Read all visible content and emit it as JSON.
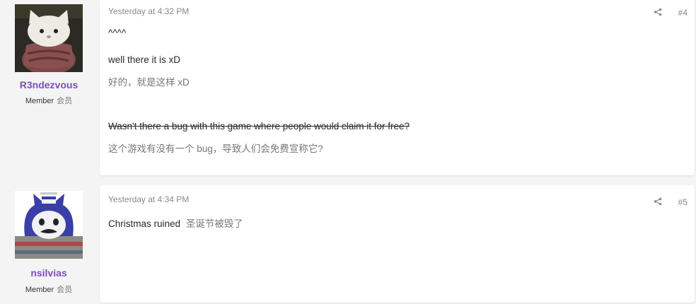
{
  "posts": [
    {
      "username": "R3ndezvous",
      "role": "Member",
      "role_tr": "会员",
      "timestamp": "Yesterday at 4:32 PM",
      "number": "#4",
      "lines": {
        "caret": "^^^^",
        "l1": "well there it is xD",
        "l1_tr": "好的，就是这样 xD",
        "l2": "Wasn't there a bug with this game where people would claim it for free?",
        "l2_tr": "这个游戏有没有一个 bug，导致人们会免费宣称它?"
      }
    },
    {
      "username": "nsilvias",
      "role": "Member",
      "role_tr": "会员",
      "timestamp": "Yesterday at 4:34 PM",
      "number": "#5",
      "lines": {
        "l1": "Christmas ruined",
        "l1_tr": "圣诞节被毁了"
      }
    }
  ],
  "colors": {
    "username": "#7b4fb8",
    "muted": "#8a8a8a",
    "page_bg": "#f4f4f4"
  },
  "icons": {
    "share": "share-icon"
  }
}
